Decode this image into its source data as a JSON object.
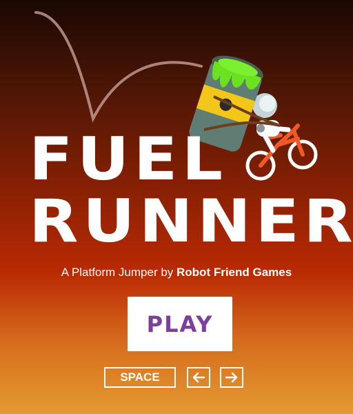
{
  "game": {
    "title_line1": "FUEL",
    "title_line2": "RUNNER",
    "subtitle_prefix": "A Platform Jumper by ",
    "subtitle_studio": "Robot Friend Games"
  },
  "menu": {
    "play_label": "PLAY"
  },
  "controls": {
    "jump_key_label": "SPACE",
    "left_key_icon": "arrow-left-icon",
    "right_key_icon": "arrow-right-icon"
  },
  "colors": {
    "background_top": "#1a0804",
    "background_mid": "#bb2a03",
    "background_bottom": "#e59a32",
    "play_text": "#7c3f9a",
    "barrel": "#5f7d73",
    "toxic_slime": "#6be21f",
    "bicycle": "#f05a28",
    "hazard_band": "#f3c61a"
  }
}
